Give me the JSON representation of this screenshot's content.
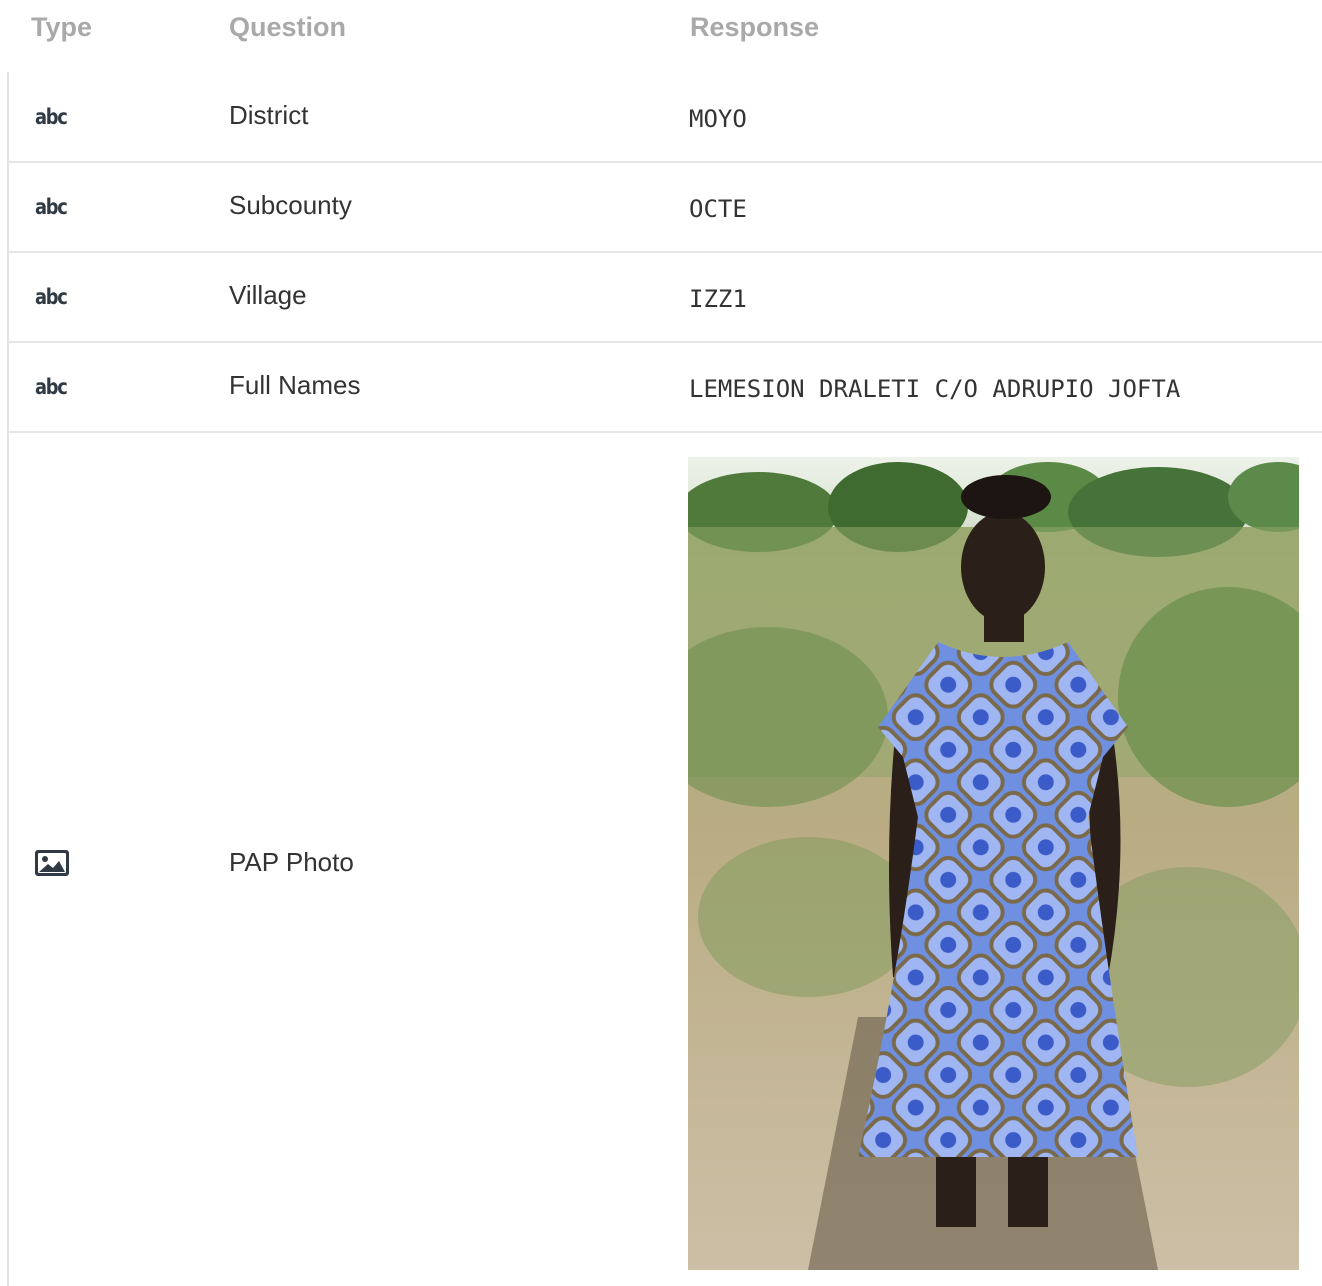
{
  "header": {
    "type_label": "Type",
    "question_label": "Question",
    "response_label": "Response"
  },
  "rows": [
    {
      "type_icon": "abc",
      "question": "District",
      "response": "MOYO"
    },
    {
      "type_icon": "abc",
      "question": "Subcounty",
      "response": "OCTE"
    },
    {
      "type_icon": "abc",
      "question": "Village",
      "response": "IZZ1"
    },
    {
      "type_icon": "abc",
      "question": "Full Names",
      "response": "LEMESION DRALETI C/O ADRUPIO JOFTA"
    }
  ],
  "photo_row": {
    "type_icon": "image-icon",
    "question": "PAP Photo",
    "response_image": "photo of a woman in a blue patterned dress standing in a field"
  },
  "colors": {
    "header_text": "#a9a9a9",
    "body_text": "#333333",
    "divider": "#e6e6e6",
    "icon": "#2f3a44"
  }
}
